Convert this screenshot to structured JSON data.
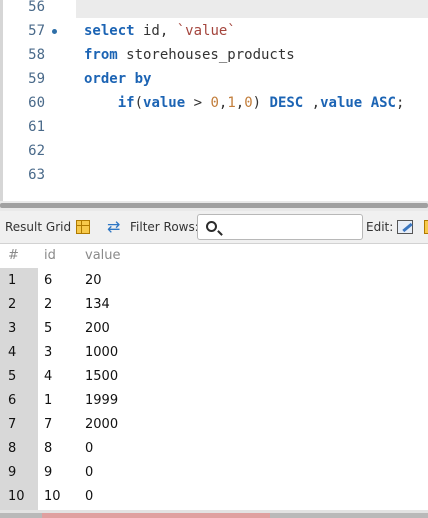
{
  "editor": {
    "lines": [
      {
        "number": "56",
        "tokens": []
      },
      {
        "number": "57",
        "breakpoint": true,
        "tokens": [
          {
            "t": "select",
            "c": "kw"
          },
          {
            "t": " id, ",
            "c": "id"
          },
          {
            "t": "`value`",
            "c": "str"
          }
        ]
      },
      {
        "number": "58",
        "tokens": [
          {
            "t": "from",
            "c": "kw"
          },
          {
            "t": " storehouses_products",
            "c": "id"
          }
        ]
      },
      {
        "number": "59",
        "tokens": [
          {
            "t": "order by",
            "c": "kw"
          }
        ]
      },
      {
        "number": "60",
        "tokens": [
          {
            "t": "    ",
            "c": "id"
          },
          {
            "t": "if",
            "c": "kw"
          },
          {
            "t": "(",
            "c": "id"
          },
          {
            "t": "value",
            "c": "kw"
          },
          {
            "t": " > ",
            "c": "id"
          },
          {
            "t": "0",
            "c": "num"
          },
          {
            "t": ",",
            "c": "id"
          },
          {
            "t": "1",
            "c": "num"
          },
          {
            "t": ",",
            "c": "id"
          },
          {
            "t": "0",
            "c": "num"
          },
          {
            "t": ") ",
            "c": "id"
          },
          {
            "t": "DESC",
            "c": "kw"
          },
          {
            "t": " ,",
            "c": "id"
          },
          {
            "t": "value",
            "c": "kw"
          },
          {
            "t": " ",
            "c": "id"
          },
          {
            "t": "ASC",
            "c": "kw"
          },
          {
            "t": ";",
            "c": "id"
          }
        ]
      },
      {
        "number": "61",
        "tokens": []
      },
      {
        "number": "62",
        "tokens": []
      },
      {
        "number": "63",
        "tokens": []
      }
    ]
  },
  "toolbar": {
    "result_grid_label": "Result Grid",
    "filter_rows_label": "Filter Rows:",
    "filter_value": "",
    "edit_label": "Edit:"
  },
  "grid": {
    "columns": [
      "#",
      "id",
      "value"
    ],
    "rows": [
      [
        "1",
        "6",
        "20"
      ],
      [
        "2",
        "2",
        "134"
      ],
      [
        "3",
        "5",
        "200"
      ],
      [
        "4",
        "3",
        "1000"
      ],
      [
        "5",
        "4",
        "1500"
      ],
      [
        "6",
        "1",
        "1999"
      ],
      [
        "7",
        "7",
        "2000"
      ],
      [
        "8",
        "8",
        "0"
      ],
      [
        "9",
        "9",
        "0"
      ],
      [
        "10",
        "10",
        "0"
      ]
    ]
  },
  "icons": {
    "grid": "result-grid-icon",
    "refresh": "refresh-icon",
    "search": "search-icon",
    "edit": "edit-icon"
  }
}
